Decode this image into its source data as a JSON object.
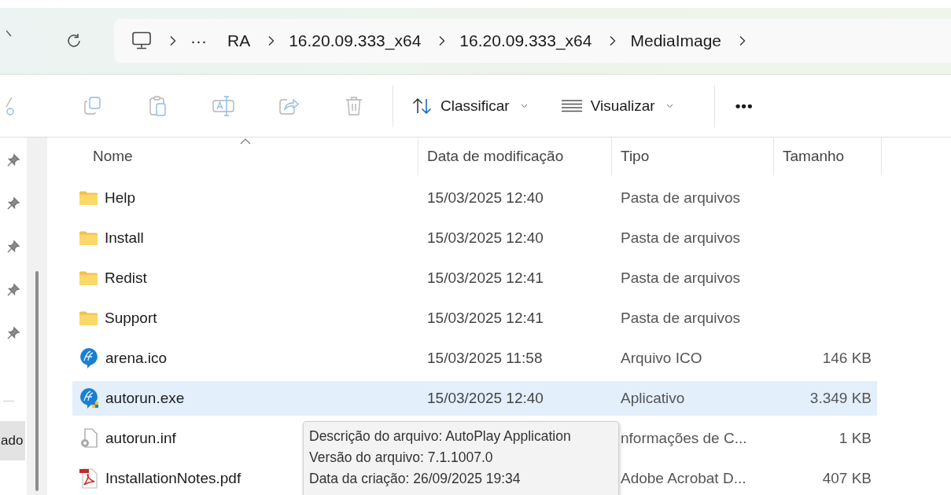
{
  "address_bar": {
    "overflow": "···",
    "segments": [
      "RA",
      "16.20.09.333_x64",
      "16.20.09.333_x64",
      "MediaImage"
    ]
  },
  "toolbar": {
    "actions": [
      {
        "kind": "cut",
        "disabled": true
      },
      {
        "kind": "copy",
        "disabled": true
      },
      {
        "kind": "paste",
        "disabled": true
      },
      {
        "kind": "rename",
        "disabled": true
      },
      {
        "kind": "share",
        "disabled": true
      },
      {
        "kind": "delete",
        "disabled": true
      }
    ],
    "sort_button": "Classificar",
    "view_button": "Visualizar",
    "more": "•••"
  },
  "sidebar": {
    "partial_label": "ado"
  },
  "columns": [
    {
      "label": "Nome",
      "sorted": true
    },
    {
      "label": "Data de modificação",
      "sorted": false
    },
    {
      "label": "Tipo",
      "sorted": false
    },
    {
      "label": "Tamanho",
      "sorted": false
    }
  ],
  "rows": [
    {
      "kind": "folder",
      "name": "Help",
      "date": "15/03/2025 12:40",
      "type": "Pasta de arquivos",
      "selected": false
    },
    {
      "kind": "folder",
      "name": "Install",
      "date": "15/03/2025 12:40",
      "type": "Pasta de arquivos",
      "selected": false
    },
    {
      "kind": "folder",
      "name": "Redist",
      "date": "15/03/2025 12:41",
      "type": "Pasta de arquivos",
      "selected": false
    },
    {
      "kind": "folder",
      "name": "Support",
      "date": "15/03/2025 12:41",
      "type": "Pasta de arquivos",
      "selected": false
    },
    {
      "kind": "icon-file",
      "name": "arena.ico",
      "date": "15/03/2025 11:58",
      "type": "Arquivo ICO",
      "size": "146 KB",
      "selected": false
    },
    {
      "kind": "program",
      "name": "autorun.exe",
      "date": "15/03/2025 12:40",
      "type": "Aplicativo",
      "size": "3.349 KB",
      "selected": true
    },
    {
      "kind": "settings-file",
      "name": "autorun.inf",
      "type": "nformações de C...",
      "size": "1 KB",
      "selected": false
    },
    {
      "kind": "pdf",
      "name": "InstallationNotes.pdf",
      "type": "Adobe Acrobat D...",
      "size": "407 KB",
      "selected": false
    }
  ],
  "tooltip": {
    "lines": [
      "Descrição do arquivo: AutoPlay Application",
      "Versão do arquivo: 7.1.1007.0",
      "Data da criação: 26/09/2025 19:34"
    ]
  }
}
